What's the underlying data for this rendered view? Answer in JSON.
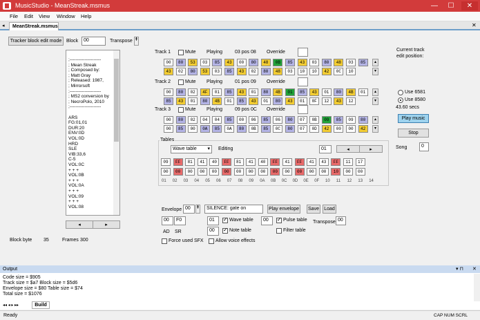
{
  "window": {
    "title": "MusicStudio - MeanStreak.msmus",
    "min": "—",
    "max": "☐",
    "close": "✕"
  },
  "menu": [
    "File",
    "Edit",
    "View",
    "Window",
    "Help"
  ],
  "doc_tab": "MeanStreak.msmus",
  "toolbar": {
    "edit_mode": "Tracker block edit mode",
    "block_label": "Block",
    "block_value": "00",
    "transpose_label": "Transpose"
  },
  "notes_lines": [
    ";---------------------",
    "; Mean Streak",
    "; Composed by:",
    "; Matt Gray",
    "; Released: 1987,",
    "; Mirrorsoft",
    ";---------------------",
    "; MS2 conversion by",
    "; NecroPolo, 2010",
    ";---------------------",
    "",
    "ARS",
    "FG:01,01",
    "DUR:20",
    "ENV:0D",
    "VOL:0D",
    "HRD",
    "SLE",
    "VIB:33,6",
    "C-5",
    "VOL:0C",
    "+ + +",
    "VOL:0B",
    "+ + +",
    "VOL:0A",
    "+ + +",
    "VOL:09",
    "+ + +",
    "VOL:08"
  ],
  "block_byte_label": "Block byte",
  "block_byte_value": "35",
  "frames_label": "Frames",
  "frames_value": "300",
  "colors": {
    "purple": "#b4b4e6",
    "yellow": "#f2cc33",
    "green": "#22a33a",
    "red": "#e86a6a"
  },
  "tracks": [
    {
      "label": "Track 1",
      "mute": "Mute",
      "playing": "Playing",
      "pos": "03 pos 08",
      "override": "Override",
      "row1": [
        [
          "00",
          "w"
        ],
        [
          "80",
          "p"
        ],
        [
          "53",
          "y"
        ],
        [
          "03",
          "w"
        ],
        [
          "85",
          "p"
        ],
        [
          "43",
          "y"
        ],
        [
          "00",
          "w"
        ],
        [
          "80",
          "p"
        ],
        [
          "48",
          "y"
        ],
        [
          "0B",
          "g"
        ],
        [
          "85",
          "p"
        ],
        [
          "43",
          "y"
        ],
        [
          "03",
          "w"
        ],
        [
          "80",
          "p"
        ],
        [
          "48",
          "y"
        ],
        [
          "03",
          "w"
        ],
        [
          "85",
          "p"
        ]
      ],
      "row2": [
        [
          "43",
          "y"
        ],
        [
          "02",
          "w"
        ],
        [
          "80",
          "p"
        ],
        [
          "53",
          "y"
        ],
        [
          "03",
          "w"
        ],
        [
          "85",
          "p"
        ],
        [
          "43",
          "y"
        ],
        [
          "02",
          "w"
        ],
        [
          "80",
          "p"
        ],
        [
          "48",
          "y"
        ],
        [
          "03",
          "w"
        ],
        [
          "10",
          "w"
        ],
        [
          "10",
          "w"
        ],
        [
          "42",
          "y"
        ],
        [
          "0C",
          "w"
        ],
        [
          "10",
          "w"
        ]
      ]
    },
    {
      "label": "Track 2",
      "mute": "Mute",
      "playing": "Playing",
      "pos": "01 pos 09",
      "override": "Override",
      "row1": [
        [
          "00",
          "w"
        ],
        [
          "80",
          "p"
        ],
        [
          "02",
          "w"
        ],
        [
          "4F",
          "y"
        ],
        [
          "01",
          "w"
        ],
        [
          "85",
          "p"
        ],
        [
          "43",
          "y"
        ],
        [
          "01",
          "w"
        ],
        [
          "80",
          "p"
        ],
        [
          "4B",
          "y"
        ],
        [
          "01",
          "g"
        ],
        [
          "85",
          "p"
        ],
        [
          "43",
          "y"
        ],
        [
          "01",
          "w"
        ],
        [
          "80",
          "p"
        ],
        [
          "4B",
          "y"
        ],
        [
          "01",
          "w"
        ]
      ],
      "row2": [
        [
          "85",
          "p"
        ],
        [
          "43",
          "y"
        ],
        [
          "01",
          "w"
        ],
        [
          "80",
          "p"
        ],
        [
          "4B",
          "y"
        ],
        [
          "01",
          "w"
        ],
        [
          "85",
          "p"
        ],
        [
          "43",
          "y"
        ],
        [
          "01",
          "w"
        ],
        [
          "80",
          "p"
        ],
        [
          "43",
          "y"
        ],
        [
          "01",
          "w"
        ],
        [
          "0F",
          "w"
        ],
        [
          "12",
          "w"
        ],
        [
          "43",
          "y"
        ],
        [
          "12",
          "w"
        ]
      ]
    },
    {
      "label": "Track 3",
      "mute": "Mute",
      "playing": "Playing",
      "pos": "09 pos 0C",
      "override": "Override",
      "row1": [
        [
          "00",
          "w"
        ],
        [
          "80",
          "p"
        ],
        [
          "02",
          "w"
        ],
        [
          "04",
          "w"
        ],
        [
          "04",
          "w"
        ],
        [
          "85",
          "p"
        ],
        [
          "00",
          "w"
        ],
        [
          "06",
          "w"
        ],
        [
          "85",
          "p"
        ],
        [
          "06",
          "w"
        ],
        [
          "80",
          "p"
        ],
        [
          "07",
          "w"
        ],
        [
          "0B",
          "w"
        ],
        [
          "09",
          "g"
        ],
        [
          "85",
          "p"
        ],
        [
          "09",
          "w"
        ],
        [
          "80",
          "p"
        ]
      ],
      "row2": [
        [
          "00",
          "w"
        ],
        [
          "85",
          "p"
        ],
        [
          "00",
          "w"
        ],
        [
          "0A",
          "p"
        ],
        [
          "85",
          "p"
        ],
        [
          "0A",
          "w"
        ],
        [
          "80",
          "p"
        ],
        [
          "0B",
          "w"
        ],
        [
          "85",
          "p"
        ],
        [
          "0C",
          "w"
        ],
        [
          "80",
          "p"
        ],
        [
          "07",
          "w"
        ],
        [
          "0D",
          "w"
        ],
        [
          "42",
          "y"
        ],
        [
          "00",
          "w"
        ],
        [
          "00",
          "w"
        ],
        [
          "42",
          "y"
        ]
      ]
    }
  ],
  "edit_position_label": "Current track\nedit position:",
  "use6581": "Use 6581",
  "use8580": "Use 8580",
  "seconds": "43.60 secs",
  "play_music": "Play music",
  "stop": "Stop",
  "song_label": "Song",
  "song_value": "0",
  "tables": {
    "title": "Tables",
    "select": "Wave table",
    "editing": "Editing",
    "value": "01",
    "cells": [
      [
        "09",
        "w"
      ],
      [
        "FF",
        "r"
      ],
      [
        "81",
        "w"
      ],
      [
        "41",
        "w"
      ],
      [
        "40",
        "w"
      ],
      [
        "FF",
        "r"
      ],
      [
        "81",
        "w"
      ],
      [
        "41",
        "w"
      ],
      [
        "40",
        "w"
      ],
      [
        "FF",
        "r"
      ],
      [
        "41",
        "w"
      ],
      [
        "FF",
        "r"
      ],
      [
        "41",
        "w"
      ],
      [
        "43",
        "w"
      ],
      [
        "FF",
        "r"
      ],
      [
        "11",
        "w"
      ],
      [
        "17",
        "w"
      ]
    ],
    "cells2": [
      [
        "00",
        "w"
      ],
      [
        "00",
        "r"
      ],
      [
        "00",
        "w"
      ],
      [
        "00",
        "w"
      ],
      [
        "00",
        "w"
      ],
      [
        "00",
        "r"
      ],
      [
        "00",
        "w"
      ],
      [
        "00",
        "w"
      ],
      [
        "00",
        "w"
      ],
      [
        "00",
        "r"
      ],
      [
        "00",
        "w"
      ],
      [
        "00",
        "r"
      ],
      [
        "00",
        "w"
      ],
      [
        "00",
        "w"
      ],
      [
        "10",
        "r"
      ],
      [
        "00",
        "w"
      ],
      [
        "00",
        "w"
      ]
    ],
    "indexes": [
      "01",
      "02",
      "03",
      "04",
      "05",
      "06",
      "07",
      "08",
      "09",
      "0A",
      "0B",
      "0C",
      "0D",
      "0E",
      "0F",
      "10",
      "11",
      "12",
      "13",
      "14"
    ]
  },
  "envelope": {
    "label": "Envelope",
    "value": "00",
    "desc": "SILENCE: gate on",
    "play": "Play envelope",
    "save": "Save",
    "load": "Load",
    "ad": "00",
    "sr": "F0",
    "ad_label": "AD",
    "sr_label": "SR",
    "wave_val": "01",
    "wave_label": "Wave table",
    "note_val": "00",
    "note_label": "Note table",
    "pulse_val": "00",
    "pulse_label": "Pulse table",
    "filter_label": "Filter table",
    "transpose_label": "Transpose",
    "transpose_val": "00",
    "force_sfx": "Force used SFX",
    "allow_fx": "Allow voice effects"
  },
  "output": {
    "title": "Output",
    "lines": [
      "Code size = $905",
      "Track size = $a7  Block size = $5d6",
      "Envelope size = $80  Table size = $74",
      "Total size = $1076"
    ],
    "tab": "Build"
  },
  "status": {
    "left": "Ready",
    "right": "CAP  NUM  SCRL"
  }
}
